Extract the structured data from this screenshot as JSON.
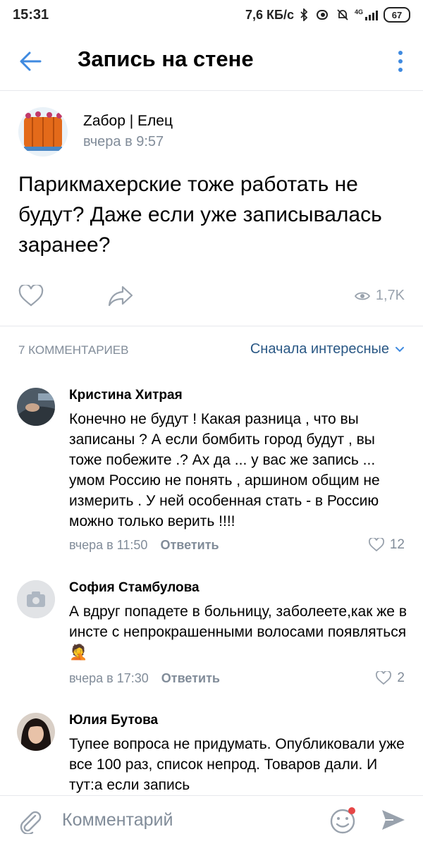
{
  "status_bar": {
    "time": "15:31",
    "speed": "7,6 КБ/с",
    "network": "4G",
    "battery": "67"
  },
  "header": {
    "title": "Запись на стене"
  },
  "post": {
    "author": "Zабор | Елец",
    "time": "вчера в 9:57",
    "text": "Парикмахерские тоже работать не будут? Даже если уже записывалась заранее?",
    "views": "1,7K"
  },
  "comments_header": {
    "count": "7 КОММЕНТАРИЕВ",
    "sort": "Сначала интересные"
  },
  "comments": [
    {
      "name": "Кристина Хитрая",
      "text": "Конечно не будут ! Какая разница , что вы записаны ? А если бомбить город будут , вы тоже побежите .? Ах да ... у вас же запись ... умом Россию не понять , аршином общим не измерить . У ней особенная стать - в Россию можно только верить !!!!",
      "time": "вчера в 11:50",
      "reply": "Ответить",
      "likes": "12"
    },
    {
      "name": "София Стамбулова",
      "text": "А вдруг попадете в больницу, заболеете,как же в инсте с непрокрашенными волосами появляться",
      "emoji": "🤦",
      "time": "вчера в 17:30",
      "reply": "Ответить",
      "likes": "2"
    },
    {
      "name": "Юлия Бутова",
      "text": "Тупее вопроса не придумать. Опубликовали уже все 100 раз, список непрод. Товаров дали. И тут:а если запись"
    }
  ],
  "bottom_bar": {
    "placeholder": "Комментарий"
  },
  "colors": {
    "accent": "#3f8ae0",
    "link": "#2a5885",
    "secondary": "#818c99",
    "notification": "#e64646"
  }
}
